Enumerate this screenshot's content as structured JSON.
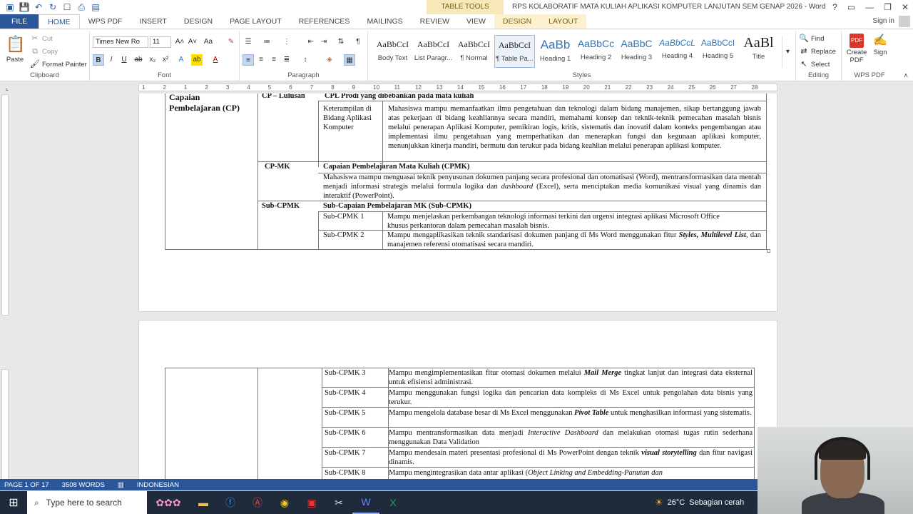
{
  "titlebar": {
    "context_tab": "TABLE TOOLS",
    "title": "RPS KOLABORATIF MATA KULIAH APLIKASI KOMPUTER LANJUTAN SEM GENAP 2026 - Word",
    "help": "?",
    "restore": "▭",
    "minimize": "—",
    "maximize": "❐",
    "close": "✕"
  },
  "tabs": [
    "FILE",
    "HOME",
    "WPS PDF",
    "INSERT",
    "DESIGN",
    "PAGE LAYOUT",
    "REFERENCES",
    "MAILINGS",
    "REVIEW",
    "VIEW"
  ],
  "context_tabs": [
    "DESIGN",
    "LAYOUT"
  ],
  "signin": "Sign in",
  "ribbon": {
    "clipboard": {
      "paste": "Paste",
      "cut": "Cut",
      "copy": "Copy",
      "format_painter": "Format Painter",
      "label": "Clipboard"
    },
    "font": {
      "name": "Times New Ro",
      "size": "11",
      "label": "Font"
    },
    "paragraph": {
      "label": "Paragraph"
    },
    "styles": {
      "items": [
        {
          "sample": "AaBbCcI",
          "name": "Body Text"
        },
        {
          "sample": "AaBbCcI",
          "name": "List Paragr..."
        },
        {
          "sample": "AaBbCcI",
          "name": "¶ Normal"
        },
        {
          "sample": "AaBbCcI",
          "name": "¶ Table Pa..."
        },
        {
          "sample": "AaBb",
          "name": "Heading 1"
        },
        {
          "sample": "AaBbCc",
          "name": "Heading 2"
        },
        {
          "sample": "AaBbC",
          "name": "Heading 3"
        },
        {
          "sample": "AaBbCcL",
          "name": "Heading 4"
        },
        {
          "sample": "AaBbCcI",
          "name": "Heading 5"
        },
        {
          "sample": "AaBl",
          "name": "Title"
        }
      ],
      "label": "Styles"
    },
    "editing": {
      "find": "Find",
      "replace": "Replace",
      "select": "Select",
      "label": "Editing"
    },
    "wps": {
      "create_pdf": "Create PDF",
      "sign": "Sign",
      "label": "WPS PDF"
    }
  },
  "ruler_numbers": [
    "1",
    "2",
    "1",
    "2",
    "3",
    "4",
    "5",
    "6",
    "7",
    "8",
    "9",
    "10",
    "11",
    "12",
    "13",
    "14",
    "15",
    "16",
    "17",
    "18",
    "19",
    "20",
    "21",
    "22",
    "23",
    "24",
    "25",
    "26",
    "27",
    "28"
  ],
  "page1": {
    "cp_label": "Capaian Pembelajaran (CP)",
    "cpl_head": "CP – Lulusan",
    "cpl_desc": "CPL Prodi yang dibebankan pada mata kuliah",
    "skill_label": "Keterampilan di Bidang Aplikasi Komputer",
    "skill_text": "Mahasiswa mampu memanfaatkan ilmu pengetahuan dan teknologi dalam bidang manajemen, sikap bertanggung jawab atas pekerjaan di bidang keahliannya secara mandiri, memahami konsep dan teknik-teknik pemecahan masalah bisnis melalui penerapan Aplikasi Komputer, pemikiran logis, kritis, sistematis dan inovatif dalam konteks pengembangan atau implementasi ilmu pengetahuan yang memperhatikan dan menerapkan fungsi dan kegunaan aplikasi komputer, menunjukkan kinerja mandiri, bermutu dan terukur pada bidang keahlian melalui penerapan aplikasi komputer.",
    "cpmk_head": "CP-MK",
    "cpmk_title": "Capaian Pembelajaran Mata Kuliah (CPMK)",
    "cpmk_text_1": "Mahasiswa mampu menguasai teknik penyusunan dokumen panjang secara profesional dan otomatisasi (Word), mentransformasikan data mentah menjadi informasi strategis melalui formula logika dan ",
    "cpmk_text_em": "dashboard",
    "cpmk_text_2": " (Excel), serta menciptakan media komunikasi visual yang dinamis dan interaktif (PowerPoint).",
    "sub_head": "Sub-CPMK",
    "sub_title": "Sub-Capaian Pembelajaran MK (Sub-CPMK)",
    "rows": [
      {
        "code": "Sub-CPMK 1",
        "text_1": "Mampu menjelaskan perkembangan teknologi informasi terkini dan urgensi integrasi aplikasi Microsoft Office khusus perkantoran dalam pemecahan masalah bisnis.",
        "em": "",
        "text_2": ""
      },
      {
        "code": "Sub-CPMK 2",
        "text_1": "Mampu mengaplikasikan teknik standarisasi dokumen panjang di Ms Word menggunakan fitur ",
        "em": "Styles, Multilevel List",
        "text_2": ", dan manajemen referensi otomatisasi secara mandiri."
      }
    ]
  },
  "page2": {
    "rows": [
      {
        "code": "Sub-CPMK 3",
        "text_1": "Mampu mengimplementasikan fitur otomasi dokumen melalui ",
        "em": "Mail Merge",
        "text_2": " tingkat lanjut dan integrasi data eksternal untuk efisiensi administrasi."
      },
      {
        "code": "Sub-CPMK 4",
        "text_1": "Mampu menggunakan fungsi logika dan pencarian data kompleks di Ms Excel untuk pengolahan data bisnis yang terukur.",
        "em": "",
        "text_2": ""
      },
      {
        "code": "Sub-CPMK 5",
        "text_1": "Mampu mengelola database besar di Ms Excel menggunakan ",
        "em": "Pivot Table",
        "text_2": " untuk menghasilkan informasi yang sistematis."
      },
      {
        "code": "Sub-CPMK 6",
        "text_1": "Mampu mentransformasikan data menjadi ",
        "em": "Interactive Dashboard",
        "text_2": " dan melakukan otomasi tugas rutin sederhana menggunakan Data Validation"
      },
      {
        "code": "Sub-CPMK 7",
        "text_1": "Mampu mendesain materi presentasi profesional di Ms PowerPoint dengan teknik ",
        "em": "visual storytelling",
        "text_2": " dan fitur navigasi dinamis."
      },
      {
        "code": "Sub-CPMK 8",
        "text_1": "Mampu mengintegrasikan data antar aplikasi (",
        "em": "Object Linking and Embedding-Panutan dan",
        "text_2": ""
      }
    ]
  },
  "status": {
    "page": "PAGE 1 OF 17",
    "words": "3508 WORDS",
    "lang": "INDONESIAN"
  },
  "taskbar": {
    "search_placeholder": "Type here to search",
    "temp": "26°C",
    "weather": "Sebagian cerah"
  }
}
